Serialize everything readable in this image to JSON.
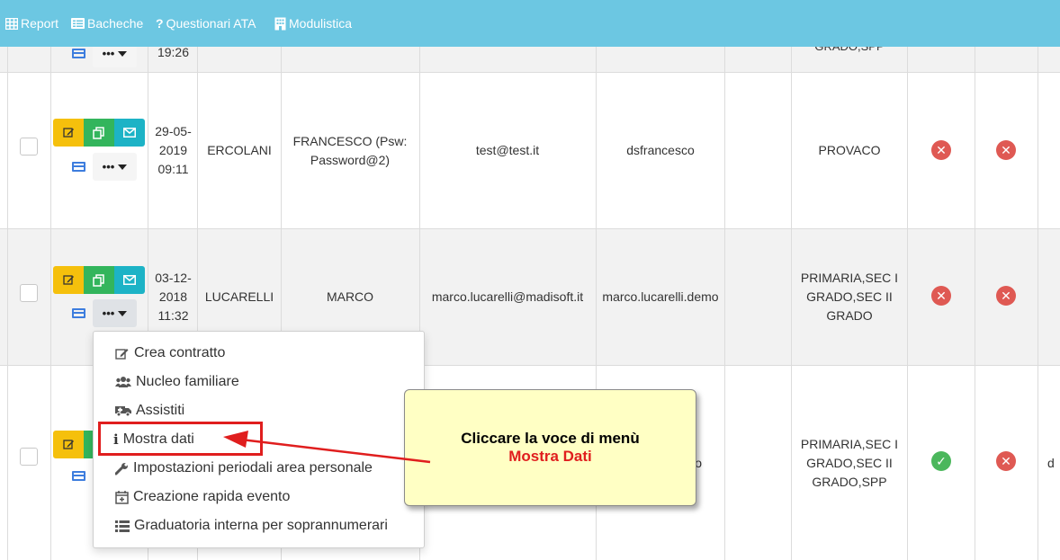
{
  "navbar": {
    "items": [
      {
        "label": "Report",
        "icon": "table-icon"
      },
      {
        "label": "Bacheche",
        "icon": "list-icon"
      },
      {
        "label": "Questionari ATA",
        "icon": "question-icon"
      },
      {
        "label": "Modulistica",
        "icon": "building-icon"
      }
    ]
  },
  "rows": [
    {
      "date": "19:26",
      "right_col": "GRADO,SPP"
    },
    {
      "date": "29-05-\n2019\n09:11",
      "cognome": "ERCOLANI",
      "nome": "FRANCESCO (Psw:\nPassword@2)",
      "email": "test@test.it",
      "username": "dsfrancesco",
      "grado": "PROVACO",
      "status1": "no",
      "status2": "no"
    },
    {
      "date": "03-12-\n2018\n11:32",
      "cognome": "LUCARELLI",
      "nome": "MARCO",
      "email": "marco.lucarelli@madisoft.it",
      "username": "marco.lucarelli.demo",
      "grado": "PRIMARIA,SEC I\nGRADO,SEC II\nGRADO",
      "status1": "no",
      "status2": "no"
    },
    {
      "username_partial": "o",
      "grado": "PRIMARIA,SEC I\nGRADO,SEC II\nGRADO,SPP",
      "status1": "yes",
      "status2": "no",
      "edge": "d"
    }
  ],
  "dropdown": {
    "items": [
      {
        "label": "Crea contratto",
        "icon": "edit-icon"
      },
      {
        "label": "Nucleo familiare",
        "icon": "users-icon"
      },
      {
        "label": "Assistiti",
        "icon": "ambulance-icon"
      },
      {
        "label": "Mostra dati",
        "icon": "info-icon"
      },
      {
        "label": "Impostazioni periodali area personale",
        "icon": "wrench-icon"
      },
      {
        "label": "Creazione rapida evento",
        "icon": "calendar-plus-icon"
      },
      {
        "label": "Graduatoria interna per soprannumerari",
        "icon": "list-icon"
      }
    ]
  },
  "callout": {
    "line1": "Cliccare la voce di menù",
    "line2": "Mostra Dati"
  },
  "colors": {
    "navbar": "#6cc7e2",
    "warning": "#f5c00c",
    "success": "#33b55c",
    "info": "#1db3c6",
    "danger": "#df5953",
    "highlight": "#e01e1e",
    "callout_bg": "#ffffc4"
  }
}
